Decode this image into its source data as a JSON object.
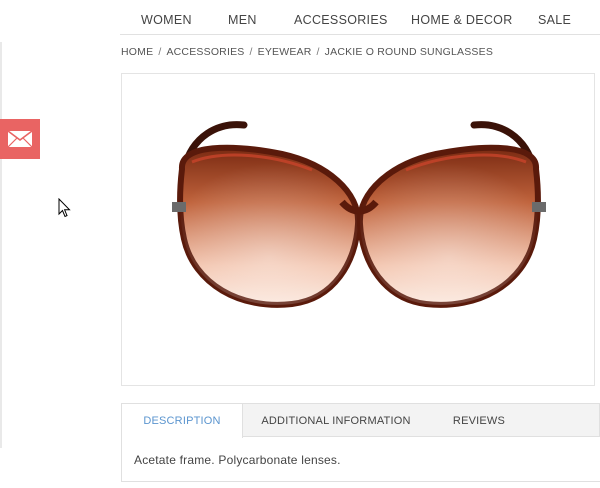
{
  "nav": {
    "items": [
      "WOMEN",
      "MEN",
      "ACCESSORIES",
      "HOME & DECOR",
      "SALE"
    ]
  },
  "breadcrumb": {
    "items": [
      "HOME",
      "ACCESSORIES",
      "EYEWEAR"
    ],
    "separator": "/",
    "current": "JACKIE O ROUND SUNGLASSES"
  },
  "sidebar": {
    "mail_icon": "envelope-icon",
    "mail_color": "#e96463"
  },
  "product": {
    "image_alt": "Jackie O Round Sunglasses"
  },
  "tabs": {
    "items": [
      "DESCRIPTION",
      "ADDITIONAL INFORMATION",
      "REVIEWS"
    ],
    "active_index": 0,
    "description_text": "Acetate frame. Polycarbonate lenses."
  },
  "colors": {
    "accent": "#5b95cf",
    "mail_tab": "#e96463"
  }
}
